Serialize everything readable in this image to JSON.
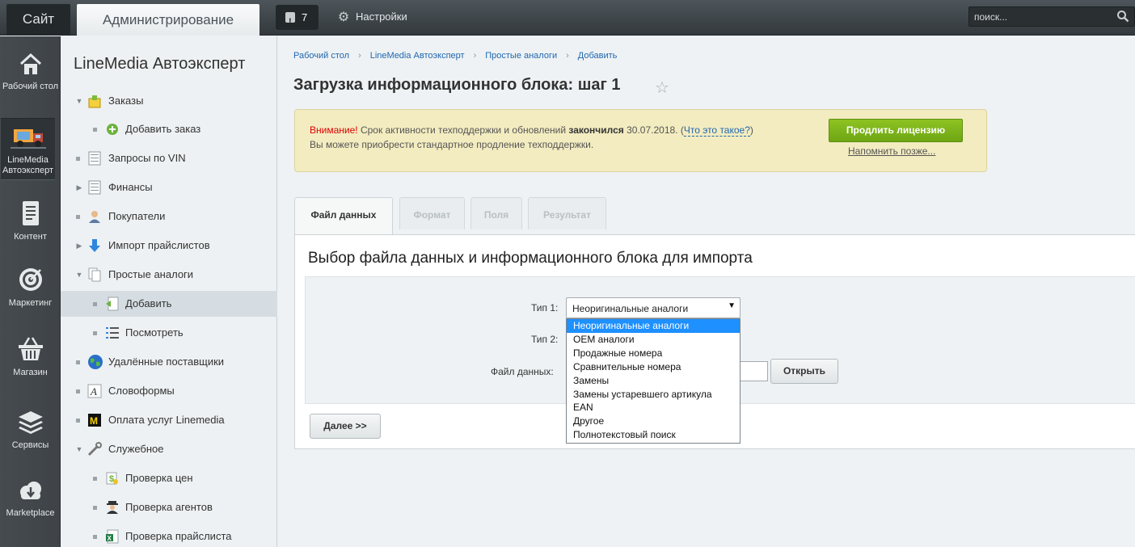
{
  "topbar": {
    "site_label": "Сайт",
    "admin_label": "Администрирование",
    "notifications_count": "7",
    "settings_label": "Настройки",
    "search_placeholder": "поиск..."
  },
  "rail": {
    "items": [
      {
        "label": "Рабочий стол",
        "icon": "home-icon"
      },
      {
        "label": "LineMedia Автоэксперт",
        "icon": "truck-icon",
        "active": true
      },
      {
        "label": "Контент",
        "icon": "document-icon"
      },
      {
        "label": "Маркетинг",
        "icon": "target-icon"
      },
      {
        "label": "Магазин",
        "icon": "basket-icon"
      },
      {
        "label": "Сервисы",
        "icon": "layers-icon"
      },
      {
        "label": "Marketplace",
        "icon": "cloud-download-icon"
      }
    ]
  },
  "sidebar": {
    "title": "LineMedia Автоэксперт",
    "items": [
      {
        "label": "Заказы",
        "icon": "orders-icon"
      },
      {
        "label": "Добавить заказ",
        "icon": "add-circle-icon"
      },
      {
        "label": "Запросы по VIN",
        "icon": "vin-icon"
      },
      {
        "label": "Финансы",
        "icon": "finance-icon"
      },
      {
        "label": "Покупатели",
        "icon": "user-icon"
      },
      {
        "label": "Импорт прайслистов",
        "icon": "download-arrow-icon"
      },
      {
        "label": "Простые аналоги",
        "icon": "pages-icon"
      },
      {
        "label": "Добавить",
        "icon": "add-page-icon",
        "selected": true
      },
      {
        "label": "Посмотреть",
        "icon": "list-icon"
      },
      {
        "label": "Удалённые поставщики",
        "icon": "globe-icon"
      },
      {
        "label": "Словоформы",
        "icon": "wordform-icon"
      },
      {
        "label": "Оплата услуг Linemedia",
        "icon": "linemedia-m-icon"
      },
      {
        "label": "Служебное",
        "icon": "tools-icon"
      },
      {
        "label": "Проверка цен",
        "icon": "price-check-icon"
      },
      {
        "label": "Проверка агентов",
        "icon": "agent-icon"
      },
      {
        "label": "Проверка прайслиста",
        "icon": "excel-icon"
      }
    ]
  },
  "breadcrumbs": [
    "Рабочий стол",
    "LineMedia Автоэксперт",
    "Простые аналоги",
    "Добавить"
  ],
  "page_title": "Загрузка информационного блока: шаг 1",
  "alert": {
    "warning_word": "Внимание!",
    "text_before": " Срок активности техподдержки и обновлений ",
    "bold_word": "закончился",
    "date": " 30.07.2018. (",
    "link": "Что это такое?",
    "close_paren": ")",
    "line2": "Вы можете приобрести стандартное продление техподдержки.",
    "button": "Продлить лицензию",
    "remind": "Напомнить позже..."
  },
  "tabs": [
    "Файл данных",
    "Формат",
    "Поля",
    "Результат"
  ],
  "panel": {
    "title": "Выбор файла данных и информационного блока для импорта",
    "type1_label": "Тип 1:",
    "type2_label": "Тип 2:",
    "file_label": "Файл данных:",
    "select_value": "Неоригинальные аналоги",
    "open_button": "Открыть",
    "next_button": "Далее >>"
  },
  "dropdown_options": [
    "Неоригинальные аналоги",
    "OEM аналоги",
    "Продажные номера",
    "Сравнительные номера",
    "Замены",
    "Замены устаревшего артикула",
    "EAN",
    "Другое",
    "Полнотекстовый поиск"
  ],
  "colors": {
    "accent_green": "#7bb31a",
    "link_blue": "#2067b0",
    "highlight": "#1e90ff",
    "warning_red": "#dd0000"
  }
}
